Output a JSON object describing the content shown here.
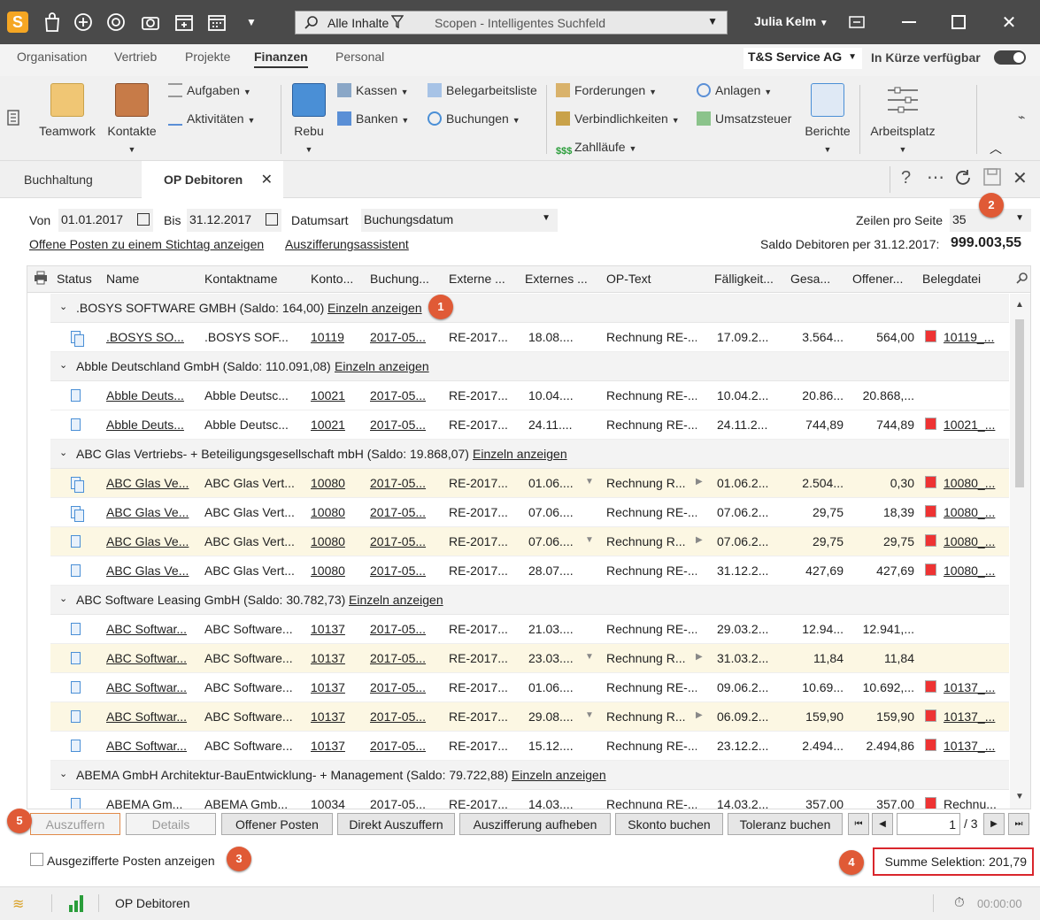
{
  "app": {
    "logo": "S",
    "search_scope": "Alle Inhalte",
    "search_placeholder": "Scopen - Intelligentes Suchfeld",
    "user": "Julia Kelm"
  },
  "menu": [
    "Organisation",
    "Vertrieb",
    "Projekte",
    "Finanzen",
    "Personal"
  ],
  "company": "T&S Service AG",
  "soon_label": "In Kürze verfügbar",
  "ribbon": {
    "teamwork": "Teamwork",
    "kontakte": "Kontakte",
    "aufgaben": "Aufgaben",
    "aktivitaeten": "Aktivitäten",
    "rebu": "Rebu",
    "kassen": "Kassen",
    "banken": "Banken",
    "belegarbeitsliste": "Belegarbeitsliste",
    "buchungen": "Buchungen",
    "forderungen": "Forderungen",
    "verbindlichkeiten": "Verbindlichkeiten",
    "zahllaeufe": "Zahlläufe",
    "anlagen": "Anlagen",
    "umsatzsteuer": "Umsatzsteuer",
    "berichte": "Berichte",
    "arbeitsplatz": "Arbeitsplatz"
  },
  "tabs": [
    "Buchhaltung",
    "OP Debitoren"
  ],
  "filter": {
    "von_label": "Von",
    "von": "01.01.2017",
    "bis_label": "Bis",
    "bis": "31.12.2017",
    "datumsart_label": "Datumsart",
    "datumsart": "Buchungsdatum",
    "zeilen_label": "Zeilen pro Seite",
    "zeilen": "35",
    "link1": "Offene Posten zu einem Stichtag anzeigen",
    "link2": "Auszifferungsassistent",
    "saldo_label": "Saldo Debitoren per 31.12.2017:",
    "saldo": "999.003,55"
  },
  "columns": [
    "Status",
    "Name",
    "Kontaktname",
    "Konto...",
    "Buchung...",
    "Externe ...",
    "Externes ...",
    "OP-Text",
    "Fälligkeit...",
    "Gesa...",
    "Offener...",
    "Belegdatei"
  ],
  "groups": [
    {
      "title": ".BOSYS SOFTWARE GMBH (Saldo: 164,00)",
      "link": "Einzeln anzeigen"
    },
    {
      "title": "Abble Deutschland GmbH (Saldo: 110.091,08)",
      "link": "Einzeln anzeigen"
    },
    {
      "title": "ABC Glas Vertriebs- + Beteiligungsgesellschaft mbH (Saldo: 19.868,07)",
      "link": "Einzeln anzeigen"
    },
    {
      "title": "ABC Software Leasing GmbH (Saldo: 30.782,73)",
      "link": "Einzeln anzeigen"
    },
    {
      "title": "ABEMA GmbH Architektur-BauEntwicklung- + Management (Saldo: 79.722,88)",
      "link": "Einzeln anzeigen"
    }
  ],
  "rows": [
    {
      "name": ".BOSYS SO...",
      "kontakt": ".BOSYS SOF...",
      "konto": "10119",
      "buchung": "2017-05...",
      "ext": "RE-2017...",
      "exts": "18.08....",
      "op": "Rechnung RE-...",
      "faell": "17.09.2...",
      "ges": "3.564...",
      "off": "564,00",
      "beleg": "10119_..."
    },
    {
      "name": "Abble Deuts...",
      "kontakt": "Abble Deutsc...",
      "konto": "10021",
      "buchung": "2017-05...",
      "ext": "RE-2017...",
      "exts": "10.04....",
      "op": "Rechnung RE-...",
      "faell": "10.04.2...",
      "ges": "20.86...",
      "off": "20.868,...",
      "beleg": ""
    },
    {
      "name": "Abble Deuts...",
      "kontakt": "Abble Deutsc...",
      "konto": "10021",
      "buchung": "2017-05...",
      "ext": "RE-2017...",
      "exts": "24.11....",
      "op": "Rechnung RE-...",
      "faell": "24.11.2...",
      "ges": "744,89",
      "off": "744,89",
      "beleg": "10021_..."
    },
    {
      "name": "ABC Glas Ve...",
      "kontakt": "ABC Glas Vert...",
      "konto": "10080",
      "buchung": "2017-05...",
      "ext": "RE-2017...",
      "exts": "01.06....",
      "op": "Rechnung R...",
      "faell": "01.06.2...",
      "ges": "2.504...",
      "off": "0,30",
      "beleg": "10080_..."
    },
    {
      "name": "ABC Glas Ve...",
      "kontakt": "ABC Glas Vert...",
      "konto": "10080",
      "buchung": "2017-05...",
      "ext": "RE-2017...",
      "exts": "07.06....",
      "op": "Rechnung RE-...",
      "faell": "07.06.2...",
      "ges": "29,75",
      "off": "18,39",
      "beleg": "10080_..."
    },
    {
      "name": "ABC Glas Ve...",
      "kontakt": "ABC Glas Vert...",
      "konto": "10080",
      "buchung": "2017-05...",
      "ext": "RE-2017...",
      "exts": "07.06....",
      "op": "Rechnung R...",
      "faell": "07.06.2...",
      "ges": "29,75",
      "off": "29,75",
      "beleg": "10080_..."
    },
    {
      "name": "ABC Glas Ve...",
      "kontakt": "ABC Glas Vert...",
      "konto": "10080",
      "buchung": "2017-05...",
      "ext": "RE-2017...",
      "exts": "28.07....",
      "op": "Rechnung RE-...",
      "faell": "31.12.2...",
      "ges": "427,69",
      "off": "427,69",
      "beleg": "10080_..."
    },
    {
      "name": "ABC Softwar...",
      "kontakt": "ABC Software...",
      "konto": "10137",
      "buchung": "2017-05...",
      "ext": "RE-2017...",
      "exts": "21.03....",
      "op": "Rechnung RE-...",
      "faell": "29.03.2...",
      "ges": "12.94...",
      "off": "12.941,...",
      "beleg": ""
    },
    {
      "name": "ABC Softwar...",
      "kontakt": "ABC Software...",
      "konto": "10137",
      "buchung": "2017-05...",
      "ext": "RE-2017...",
      "exts": "23.03....",
      "op": "Rechnung R...",
      "faell": "31.03.2...",
      "ges": "11,84",
      "off": "11,84",
      "beleg": ""
    },
    {
      "name": "ABC Softwar...",
      "kontakt": "ABC Software...",
      "konto": "10137",
      "buchung": "2017-05...",
      "ext": "RE-2017...",
      "exts": "01.06....",
      "op": "Rechnung RE-...",
      "faell": "09.06.2...",
      "ges": "10.69...",
      "off": "10.692,...",
      "beleg": "10137_..."
    },
    {
      "name": "ABC Softwar...",
      "kontakt": "ABC Software...",
      "konto": "10137",
      "buchung": "2017-05...",
      "ext": "RE-2017...",
      "exts": "29.08....",
      "op": "Rechnung R...",
      "faell": "06.09.2...",
      "ges": "159,90",
      "off": "159,90",
      "beleg": "10137_..."
    },
    {
      "name": "ABC Softwar...",
      "kontakt": "ABC Software...",
      "konto": "10137",
      "buchung": "2017-05...",
      "ext": "RE-2017...",
      "exts": "15.12....",
      "op": "Rechnung RE-...",
      "faell": "23.12.2...",
      "ges": "2.494...",
      "off": "2.494,86",
      "beleg": "10137_..."
    },
    {
      "name": "ABEMA Gm...",
      "kontakt": "ABEMA Gmb...",
      "konto": "10034",
      "buchung": "2017-05...",
      "ext": "RE-2017...",
      "exts": "14.03....",
      "op": "Rechnung RE-...",
      "faell": "14.03.2...",
      "ges": "357,00",
      "off": "357,00",
      "beleg": "Rechnu..."
    }
  ],
  "buttons": [
    "Auszuffern",
    "Details",
    "Offener Posten",
    "Direkt Auszuffern",
    "Auszifferung aufheben",
    "Skonto buchen",
    "Toleranz buchen"
  ],
  "pager": {
    "page": "1",
    "total": "/ 3"
  },
  "checkbox_label": "Ausgezifferte Posten anzeigen",
  "summe": "Summe Selektion: 201,79",
  "badges": [
    "1",
    "2",
    "3",
    "4",
    "5"
  ],
  "status_tab": "OP Debitoren",
  "timer": "00:00:00",
  "colors": {
    "titlebar": "#4a4a4a",
    "highlight_row": "#fcf7e3",
    "badge": "#e05a36",
    "summe_border": "#d9262c"
  }
}
